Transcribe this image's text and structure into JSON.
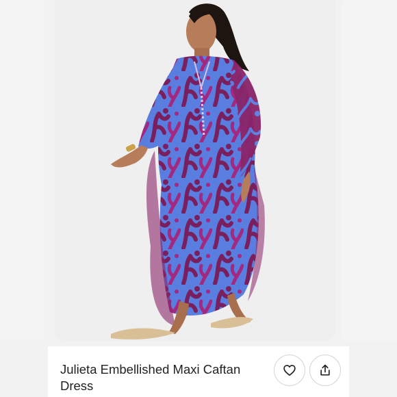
{
  "product": {
    "title": "Julieta Embellished Maxi Caftan Dress",
    "image_subject": "model wearing blue and purple coral print caftan dress"
  },
  "actions": {
    "like_icon": "heart-outline",
    "share_icon": "share-upload"
  },
  "colors": {
    "page_background": "#f2f2f2",
    "photo_background": "#efefef",
    "dress_blue": "#5a7ee0",
    "dress_purple": "#7a1f5e",
    "dress_magenta": "#a3287f",
    "text_primary": "#222222",
    "button_border": "#d6d6d6"
  }
}
